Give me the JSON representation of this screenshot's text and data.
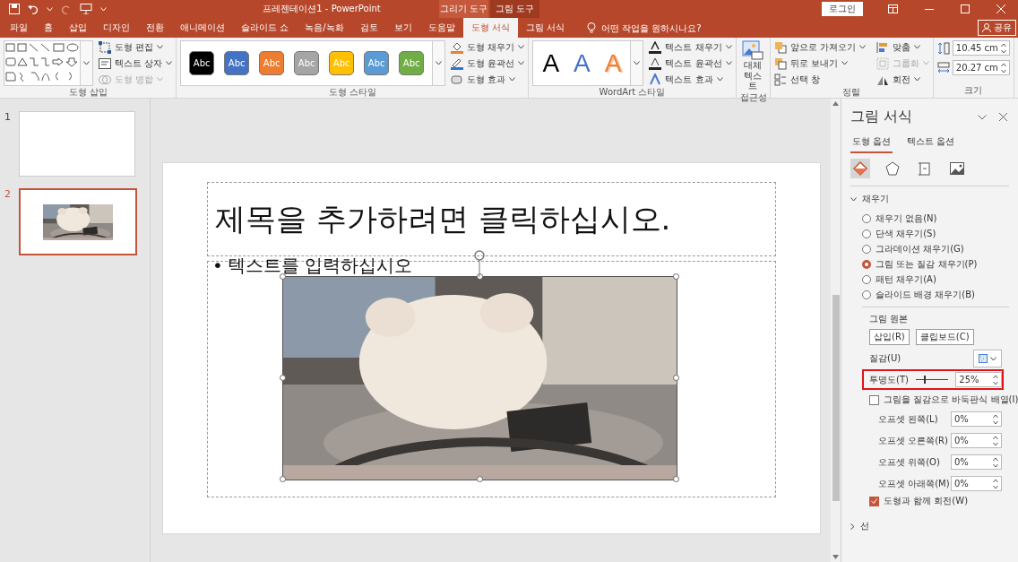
{
  "window": {
    "title": "프레젠테이션1  -  PowerPoint",
    "login": "로그인"
  },
  "context_headers": [
    {
      "label": "그리기 도구",
      "kind": "drawing"
    },
    {
      "label": "그림 도구",
      "kind": "picture"
    }
  ],
  "tabs": [
    {
      "label": "파일",
      "selected": false
    },
    {
      "label": "홈",
      "selected": false
    },
    {
      "label": "삽입",
      "selected": false
    },
    {
      "label": "디자인",
      "selected": false
    },
    {
      "label": "전환",
      "selected": false
    },
    {
      "label": "애니메이션",
      "selected": false
    },
    {
      "label": "슬라이드 쇼",
      "selected": false
    },
    {
      "label": "녹음/녹화",
      "selected": false
    },
    {
      "label": "검토",
      "selected": false
    },
    {
      "label": "보기",
      "selected": false
    },
    {
      "label": "도움말",
      "selected": false
    },
    {
      "label": "도형 서식",
      "selected": true
    },
    {
      "label": "그림 서식",
      "selected": false
    }
  ],
  "tell_me": {
    "placeholder": "어떤 작업을 원하시나요?"
  },
  "share": {
    "label": "공유"
  },
  "ribbon": {
    "shape_insert": {
      "title": "도형 삽입",
      "commands": [
        {
          "label": "도형 편집",
          "menu": true,
          "disabled": false
        },
        {
          "label": "텍스트 상자",
          "menu": true,
          "disabled": false
        },
        {
          "label": "도형 병합",
          "menu": true,
          "disabled": true
        }
      ]
    },
    "shape_styles": {
      "title": "도형 스타일",
      "swatches": [
        {
          "label": "Abc",
          "color": "#000000"
        },
        {
          "label": "Abc",
          "color": "#4472c4"
        },
        {
          "label": "Abc",
          "color": "#ed7d31"
        },
        {
          "label": "Abc",
          "color": "#a5a5a5"
        },
        {
          "label": "Abc",
          "color": "#ffc000"
        },
        {
          "label": "Abc",
          "color": "#5b9bd5"
        },
        {
          "label": "Abc",
          "color": "#70ad47"
        }
      ],
      "commands": [
        {
          "label": "도형 채우기",
          "menu": true,
          "disabled": false
        },
        {
          "label": "도형 윤곽선",
          "menu": true,
          "disabled": false
        },
        {
          "label": "도형 효과",
          "menu": true,
          "disabled": false
        }
      ]
    },
    "wordart": {
      "title": "WordArt 스타일",
      "samples": [
        {
          "label": "A",
          "color": "#000000",
          "kind": "fill"
        },
        {
          "label": "A",
          "color": "#4472c4",
          "kind": "fill"
        },
        {
          "label": "A",
          "color": "#ed7d31",
          "kind": "outline"
        }
      ],
      "commands": [
        {
          "label": "텍스트 채우기",
          "menu": true,
          "disabled": false
        },
        {
          "label": "텍스트 윤곽선",
          "menu": true,
          "disabled": false
        },
        {
          "label": "텍스트 효과",
          "menu": true,
          "disabled": false
        }
      ]
    },
    "accessibility": {
      "title": "접근성",
      "button": "대체 텍스트"
    },
    "arrange": {
      "title": "정렬",
      "commands": [
        {
          "label": "앞으로 가져오기",
          "menu": true,
          "disabled": false
        },
        {
          "label": "맞춤",
          "menu": true,
          "disabled": false
        },
        {
          "label": "뒤로 보내기",
          "menu": true,
          "disabled": false
        },
        {
          "label": "그룹화",
          "menu": true,
          "disabled": true
        },
        {
          "label": "선택 창",
          "menu": false,
          "disabled": false
        },
        {
          "label": "회전",
          "menu": true,
          "disabled": false
        }
      ]
    },
    "size": {
      "title": "크기",
      "fields": [
        {
          "value": "10.45 cm"
        },
        {
          "value": "20.27 cm"
        }
      ]
    }
  },
  "slides": [
    {
      "number": "1",
      "selected": false,
      "kind": "blank"
    },
    {
      "number": "2",
      "selected": true,
      "kind": "picture"
    }
  ],
  "slide": {
    "title": "제목을 추가하려면 클릭하십시오.",
    "bullet": "•",
    "body": "텍스트를 입력하십시오"
  },
  "format_pane": {
    "title": "그림 서식",
    "tabs": [
      {
        "label": "도형 옵션",
        "selected": true
      },
      {
        "label": "텍스트 옵션",
        "selected": false
      }
    ],
    "icon_tabs": [
      {
        "selected": true
      },
      {
        "selected": false
      },
      {
        "selected": false
      },
      {
        "selected": false
      }
    ],
    "fill": {
      "label": "채우기",
      "expanded": true,
      "options": [
        {
          "label": "채우기 없음(N)",
          "selected": false
        },
        {
          "label": "단색 채우기(S)",
          "selected": false
        },
        {
          "label": "그라데이션 채우기(G)",
          "selected": false
        },
        {
          "label": "그림 또는 질감 채우기(P)",
          "selected": true
        },
        {
          "label": "패턴 채우기(A)",
          "selected": false
        },
        {
          "label": "슬라이드 배경 채우기(B)",
          "selected": false
        }
      ]
    },
    "source": {
      "label": "그림 원본",
      "buttons": [
        "삽입(R)",
        "클립보드(C)"
      ]
    },
    "texture": {
      "label": "질감(U)"
    },
    "transparency": {
      "label": "투명도(T)",
      "level": 0.25,
      "value": "25%",
      "highlighted": true
    },
    "tile": {
      "label": "그림을 질감으로 바둑판식 배열(I)",
      "checked": false
    },
    "offsets": [
      {
        "label": "오프셋 왼쪽(L)",
        "value": "0%"
      },
      {
        "label": "오프셋 오른쪽(R)",
        "value": "0%"
      },
      {
        "label": "오프셋 위쪽(O)",
        "value": "0%"
      },
      {
        "label": "오프셋 아래쪽(M)",
        "value": "0%"
      }
    ],
    "rotate": {
      "label": "도형과 함께 회전(W)",
      "checked": true
    },
    "line": {
      "label": "선",
      "expanded": false
    }
  }
}
